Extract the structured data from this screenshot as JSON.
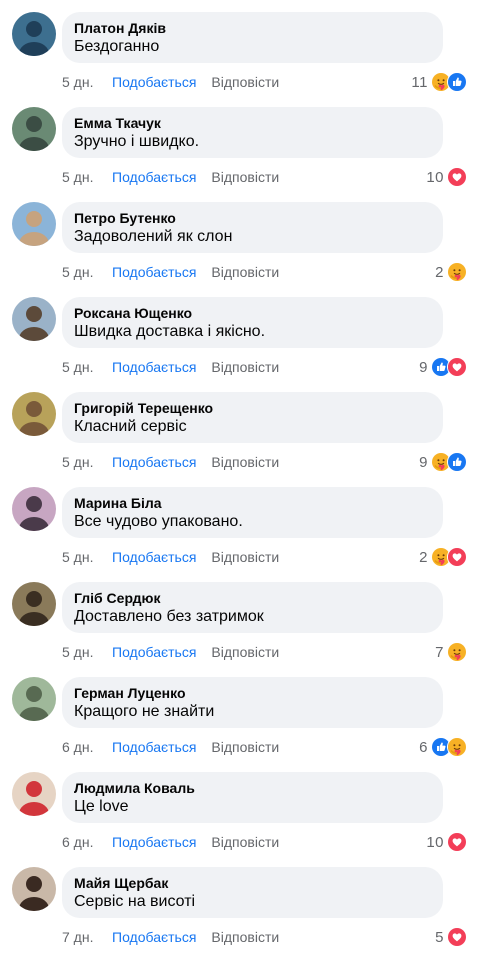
{
  "comments": [
    {
      "name": "Платон Дяків",
      "text": "Бездоганно",
      "time": "5 дн.",
      "like_label": "Подобається",
      "reply_label": "Відповісти",
      "reactions_count": "11",
      "reactions": [
        "care-emoji",
        "like-emoji"
      ],
      "avatar_colors": [
        "#3d6f8f",
        "#1f3f59"
      ]
    },
    {
      "name": "Емма Ткачук",
      "text": "Зручно і швидко.",
      "time": "5 дн.",
      "like_label": "Подобається",
      "reply_label": "Відповісти",
      "reactions_count": "10",
      "reactions": [
        "love-emoji"
      ],
      "avatar_colors": [
        "#6a8a74",
        "#3b4d44"
      ]
    },
    {
      "name": "Петро Бутенко",
      "text": "Задоволений як слон",
      "time": "5 дн.",
      "like_label": "Подобається",
      "reply_label": "Відповісти",
      "reactions_count": "2",
      "reactions": [
        "care-emoji"
      ],
      "avatar_colors": [
        "#8bb4d8",
        "#c6a37f"
      ]
    },
    {
      "name": "Роксана Ющенко",
      "text": "Швидка доставка і якісно.",
      "time": "5 дн.",
      "like_label": "Подобається",
      "reply_label": "Відповісти",
      "reactions_count": "9",
      "reactions": [
        "like-emoji",
        "love-emoji"
      ],
      "avatar_colors": [
        "#9ab2c8",
        "#5c4a3a"
      ]
    },
    {
      "name": "Григорій Терещенко",
      "text": "Класний сервіс",
      "time": "5 дн.",
      "like_label": "Подобається",
      "reply_label": "Відповісти",
      "reactions_count": "9",
      "reactions": [
        "care-emoji",
        "like-emoji"
      ],
      "avatar_colors": [
        "#b8a25a",
        "#7a5a3a"
      ]
    },
    {
      "name": "Марина Біла",
      "text": "Все чудово упаковано.",
      "time": "5 дн.",
      "like_label": "Подобається",
      "reply_label": "Відповісти",
      "reactions_count": "2",
      "reactions": [
        "care-emoji",
        "love-emoji"
      ],
      "avatar_colors": [
        "#c7a6c2",
        "#4a3a4a"
      ]
    },
    {
      "name": "Гліб Сердюк",
      "text": "Доставлено без затримок",
      "time": "5 дн.",
      "like_label": "Подобається",
      "reply_label": "Відповісти",
      "reactions_count": "7",
      "reactions": [
        "care-emoji"
      ],
      "avatar_colors": [
        "#8a7a5a",
        "#3a2e22"
      ]
    },
    {
      "name": "Герман Луценко",
      "text": "Кращого не знайти",
      "time": "6 дн.",
      "like_label": "Подобається",
      "reply_label": "Відповісти",
      "reactions_count": "6",
      "reactions": [
        "like-emoji",
        "care-emoji"
      ],
      "avatar_colors": [
        "#9fb89a",
        "#586a52"
      ]
    },
    {
      "name": "Людмила Коваль",
      "text": "Це love",
      "time": "6 дн.",
      "like_label": "Подобається",
      "reply_label": "Відповісти",
      "reactions_count": "10",
      "reactions": [
        "love-emoji"
      ],
      "avatar_colors": [
        "#e6d4c4",
        "#d2363c"
      ]
    },
    {
      "name": "Майя Щербак",
      "text": "Сервіс на висоті",
      "time": "7 дн.",
      "like_label": "Подобається",
      "reply_label": "Відповісти",
      "reactions_count": "5",
      "reactions": [
        "love-emoji"
      ],
      "avatar_colors": [
        "#c9b8a8",
        "#3a2a22"
      ]
    }
  ],
  "colors": {
    "bubble_bg": "#f0f2f5",
    "like_blue": "#1877f2",
    "love_red": "#f33e58",
    "care_yellow": "#f7b125",
    "meta_gray": "#65676b"
  }
}
